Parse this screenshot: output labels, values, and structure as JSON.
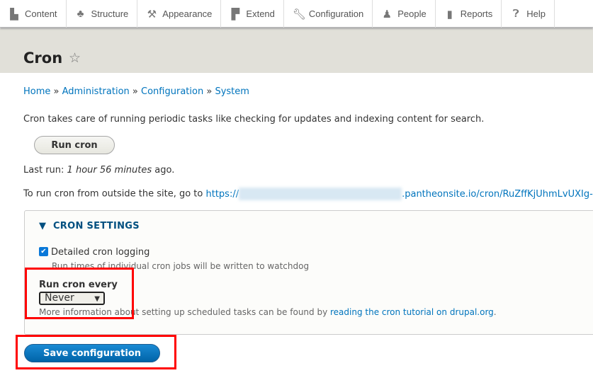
{
  "toolbar": {
    "items": [
      {
        "label": "Content",
        "icon": "file-icon"
      },
      {
        "label": "Structure",
        "icon": "sitemap-icon"
      },
      {
        "label": "Appearance",
        "icon": "paintbrush-icon"
      },
      {
        "label": "Extend",
        "icon": "puzzle-icon"
      },
      {
        "label": "Configuration",
        "icon": "wrench-icon"
      },
      {
        "label": "People",
        "icon": "people-icon"
      },
      {
        "label": "Reports",
        "icon": "bar-chart-icon"
      },
      {
        "label": "Help",
        "icon": "help-icon"
      }
    ]
  },
  "page": {
    "title": "Cron"
  },
  "breadcrumb": [
    "Home",
    "Administration",
    "Configuration",
    "System"
  ],
  "breadcrumb_sep": "»",
  "description": "Cron takes care of running periodic tasks like checking for updates and indexing content for search.",
  "run_cron_label": "Run cron",
  "last_run": {
    "prefix": "Last run: ",
    "value": "1 hour 56 minutes",
    "suffix": " ago."
  },
  "url_line": {
    "prefix": "To run cron from outside the site, go to ",
    "url_start": "https://",
    "url_end": ".pantheonsite.io/cron/RuZffKjUhmLvUXIg-I"
  },
  "settings": {
    "legend": "CRON SETTINGS",
    "logging_label": "Detailed cron logging",
    "logging_checked": true,
    "logging_help": "Run times of individual cron jobs will be written to watchdog",
    "run_every_label": "Run cron every",
    "run_every_value": "Never",
    "help_prefix": "More information about setting up scheduled tasks can be found by ",
    "help_link": "reading the cron tutorial on drupal.org",
    "help_suffix": "."
  },
  "save_label": "Save configuration",
  "colors": {
    "link": "#0074bd",
    "highlight": "#ff0000",
    "primary": "#0071b8"
  }
}
